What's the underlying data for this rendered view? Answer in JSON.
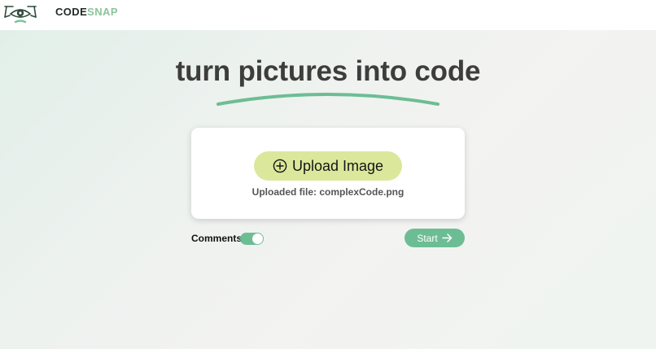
{
  "header": {
    "brand_part1": "CODE",
    "brand_part2": "SNAP",
    "logo_icon": "camera-eye-logo"
  },
  "hero": {
    "headline": "turn pictures into code"
  },
  "upload": {
    "button_label": "Upload Image",
    "button_icon": "plus-circle-icon",
    "file_info": "Uploaded file: complexCode.png"
  },
  "options": {
    "comments_label": "Comments",
    "comments_enabled": true
  },
  "actions": {
    "start_label": "Start",
    "start_icon": "arrow-right-icon"
  },
  "colors": {
    "accent_green": "#6dbd94",
    "upload_button": "#dbe89b",
    "brand_dark": "#1f2a24",
    "brand_light": "#8ec39b",
    "headline": "#3d3d3d"
  }
}
